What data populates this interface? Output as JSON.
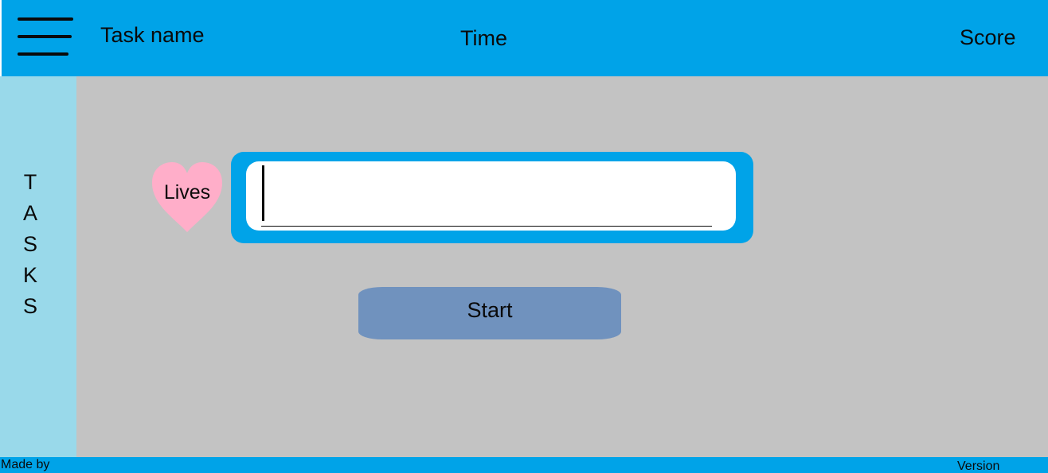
{
  "header": {
    "menu_icon": "hamburger-menu-icon",
    "task_name": "Task name",
    "time": "Time",
    "score": "Score"
  },
  "sidebar": {
    "letters": [
      "T",
      "A",
      "S",
      "K",
      "S"
    ]
  },
  "main": {
    "lives_label": "Lives",
    "lives_icon": "heart-icon",
    "answer_input": {
      "value": "",
      "placeholder": ""
    },
    "start_label": "Start"
  },
  "footer": {
    "made_by": "Made by",
    "version": "Version"
  },
  "colors": {
    "header": "#00a3e8",
    "sidebar": "#99d9ea",
    "main": "#c3c3c3",
    "heart": "#ffaec9",
    "input_frame": "#00a3e8",
    "start_button": "#7092be"
  }
}
